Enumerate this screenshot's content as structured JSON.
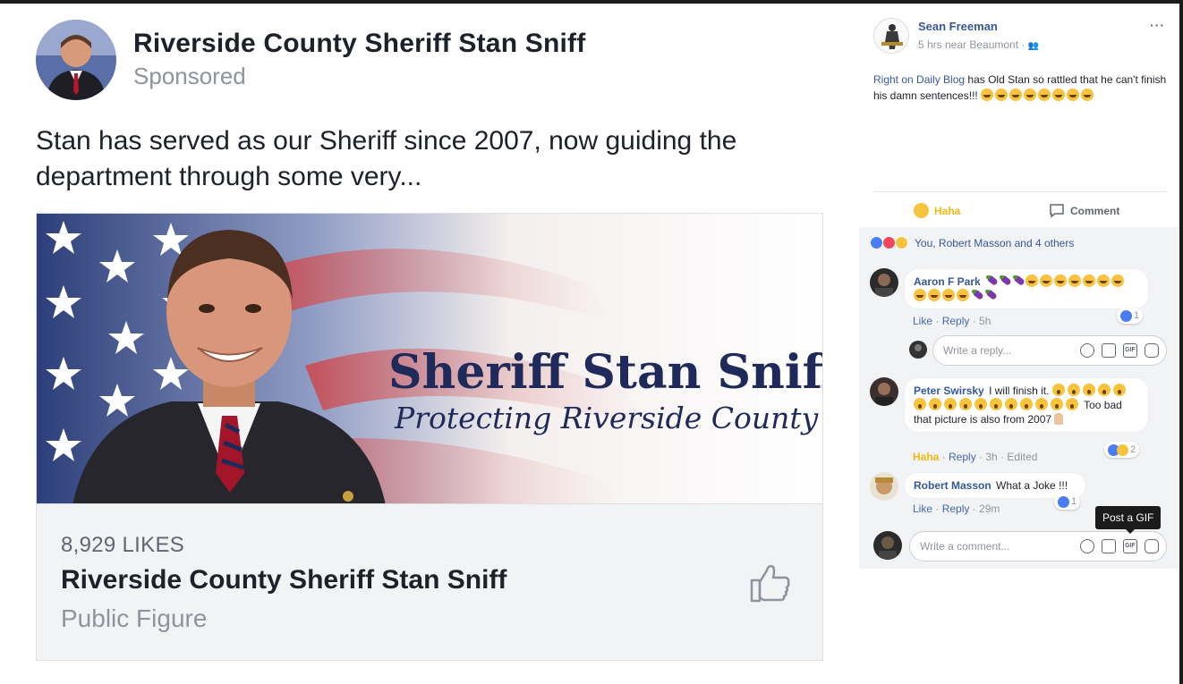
{
  "ad": {
    "page_name": "Riverside County Sheriff Stan Sniff",
    "sponsored_label": "Sponsored",
    "text": "Stan has served as our Sheriff since 2007, now guiding the department through some very...",
    "banner_title": "Sheriff Stan Sniff",
    "banner_subtitle": "Protecting Riverside County",
    "likes": "8,929 LIKES",
    "footer_name": "Riverside County Sheriff Stan Sniff",
    "category": "Public Figure"
  },
  "post": {
    "author": "Sean Freeman",
    "meta": "5 hrs near Beaumont · ",
    "menu_label": "···",
    "link_text": "Right on Daily Blog",
    "body_text": " has Old Stan so rattled that he can't finish his damn sentences!!!",
    "haha_label": "Haha",
    "comment_label": "Comment",
    "reactions_summary": "You, Robert Masson and 4 others"
  },
  "comments": [
    {
      "name": "Aaron F Park",
      "text": "",
      "actions": [
        "Like",
        "Reply",
        "5h"
      ],
      "reaction_count": "1"
    },
    {
      "name": "Peter Swirsky",
      "text": "I will finish it.",
      "text2": "Too bad that picture is also from 2007",
      "actions": [
        "Haha",
        "Reply",
        "3h",
        "Edited"
      ],
      "reaction_count": "2"
    },
    {
      "name": "Robert Masson",
      "text": "What a Joke !!!",
      "actions": [
        "Like",
        "Reply",
        "29m"
      ],
      "reaction_count": "1"
    }
  ],
  "reply_input": {
    "placeholder": "Write a reply..."
  },
  "comment_input": {
    "placeholder": "Write a comment..."
  },
  "gif_icon_text": "GIF",
  "tooltip": "Post a GIF",
  "colors": {
    "facebook_link": "#365899",
    "haha_yellow": "#f0ba15",
    "banner_navy": "#1f2a5a"
  }
}
